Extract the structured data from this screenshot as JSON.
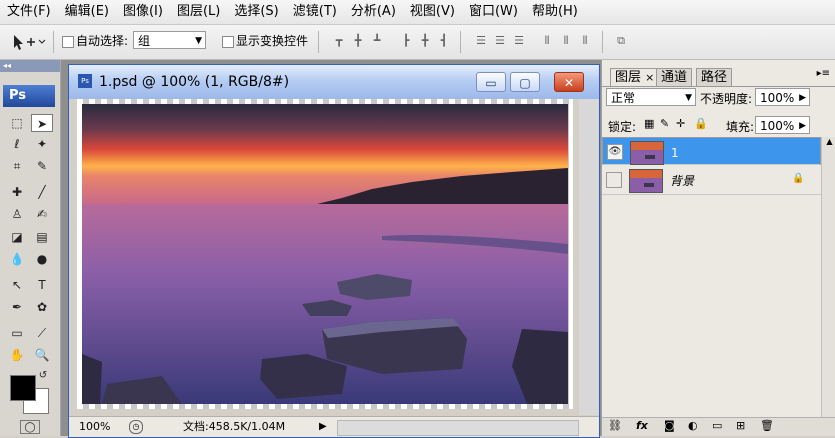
{
  "menubar": {
    "items": [
      "文件(F)",
      "编辑(E)",
      "图像(I)",
      "图层(L)",
      "选择(S)",
      "滤镜(T)",
      "分析(A)",
      "视图(V)",
      "窗口(W)",
      "帮助(H)"
    ]
  },
  "options": {
    "tool_icon": "move-tool-icon",
    "auto_select_label": "自动选择:",
    "auto_select_value": "组",
    "show_transform_label": "显示变换控件"
  },
  "toolbox": {
    "collapse": "◂◂",
    "logo": "Ps"
  },
  "document": {
    "title": "1.psd @ 100% (1, RGB/8#)",
    "zoom": "100%",
    "doc_info": "文档:458.5K/1.04M",
    "min_btn": "▭",
    "max_btn": "▢",
    "close_btn": "✕"
  },
  "panel": {
    "tabs": [
      "图层",
      "通道",
      "路径"
    ],
    "tab_close": "×",
    "blend_mode": "正常",
    "opacity_label": "不透明度:",
    "opacity_value": "100%",
    "lock_label": "锁定:",
    "fill_label": "填充:",
    "fill_value": "100%",
    "layers": [
      {
        "name": "1",
        "visible": true,
        "selected": true
      },
      {
        "name": "背景",
        "visible": false,
        "selected": false,
        "locked": true
      }
    ]
  },
  "colors": {
    "accent": "#3e95ec",
    "titlebar": "#9db9ea",
    "close": "#c8401c"
  }
}
